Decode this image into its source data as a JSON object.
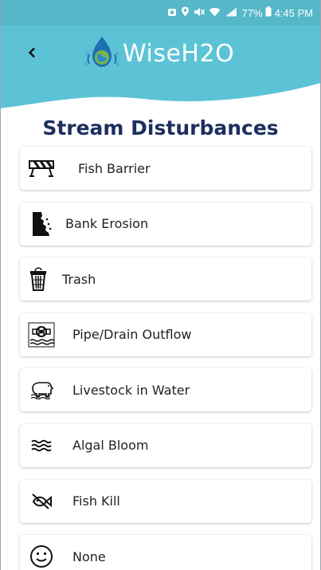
{
  "status_bar": {
    "battery": "77%",
    "time": "4:45 PM"
  },
  "header": {
    "back_icon": "chevron-left-icon",
    "app_name": "WiseH2O",
    "logo_icon": "globe-drop-icon",
    "wave_color": "#5cc3d6",
    "title": "Stream Disturbances"
  },
  "disturbances": [
    {
      "label": "Fish Barrier",
      "icon": "barrier-icon"
    },
    {
      "label": "Bank Erosion",
      "icon": "erosion-icon"
    },
    {
      "label": "Trash",
      "icon": "trash-can-icon"
    },
    {
      "label": "Pipe/Drain Outflow",
      "icon": "pipe-outflow-icon"
    },
    {
      "label": "Livestock in Water",
      "icon": "livestock-icon"
    },
    {
      "label": "Algal Bloom",
      "icon": "algal-bloom-icon"
    },
    {
      "label": "Fish Kill",
      "icon": "fish-kill-icon"
    },
    {
      "label": "None",
      "icon": "smiley-icon"
    }
  ]
}
